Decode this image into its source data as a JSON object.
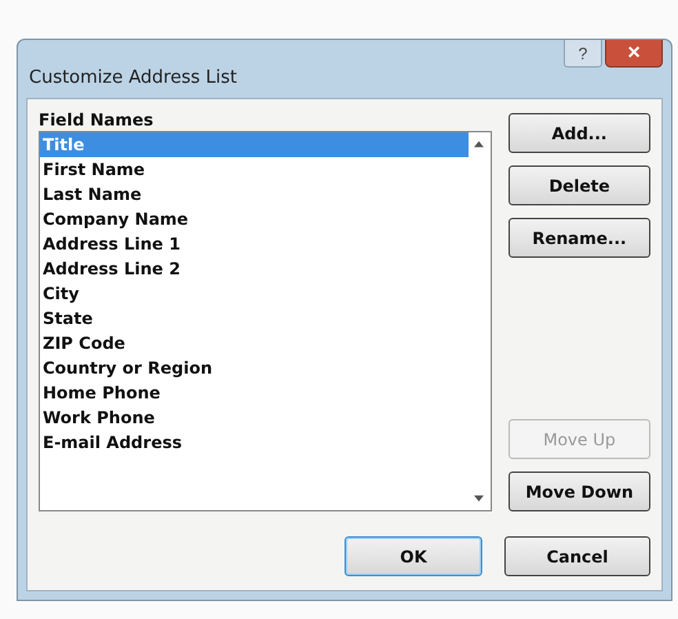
{
  "window": {
    "title": "Customize Address List",
    "help_button": "?",
    "close_button": "×"
  },
  "field_names": {
    "label": "Field Names",
    "items": [
      {
        "label": "Title",
        "selected": true
      },
      {
        "label": "First Name",
        "selected": false
      },
      {
        "label": "Last Name",
        "selected": false
      },
      {
        "label": "Company Name",
        "selected": false
      },
      {
        "label": "Address Line 1",
        "selected": false
      },
      {
        "label": "Address Line 2",
        "selected": false
      },
      {
        "label": "City",
        "selected": false
      },
      {
        "label": "State",
        "selected": false
      },
      {
        "label": "ZIP Code",
        "selected": false
      },
      {
        "label": "Country or Region",
        "selected": false
      },
      {
        "label": "Home Phone",
        "selected": false
      },
      {
        "label": "Work Phone",
        "selected": false
      },
      {
        "label": "E-mail Address",
        "selected": false
      }
    ]
  },
  "side_buttons_top": [
    {
      "label": "Add...",
      "disabled": false
    },
    {
      "label": "Delete",
      "disabled": false
    },
    {
      "label": "Rename...",
      "disabled": false
    }
  ],
  "side_buttons_bottom": [
    {
      "label": "Move Up",
      "disabled": true
    },
    {
      "label": "Move Down",
      "disabled": false
    }
  ],
  "footer_buttons": [
    {
      "label": "OK",
      "default": true
    },
    {
      "label": "Cancel",
      "default": false
    }
  ]
}
